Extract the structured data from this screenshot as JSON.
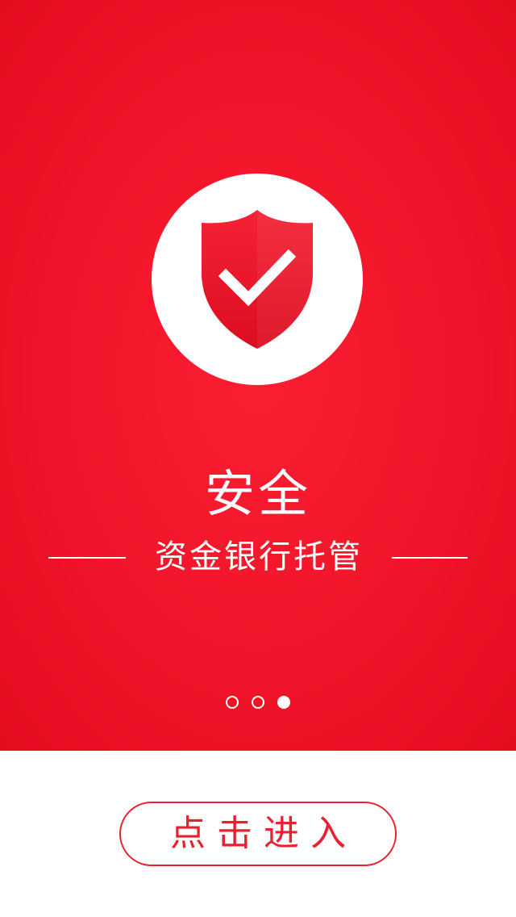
{
  "onboarding": {
    "headline": "安全",
    "subline": "资金银行托管",
    "icon": "shield-check-icon",
    "pager": {
      "total": 3,
      "active_index": 2
    },
    "enter_button_label": "点击进入"
  },
  "colors": {
    "brand_red": "#f1142a",
    "button_red": "#e8202f",
    "white": "#ffffff"
  }
}
